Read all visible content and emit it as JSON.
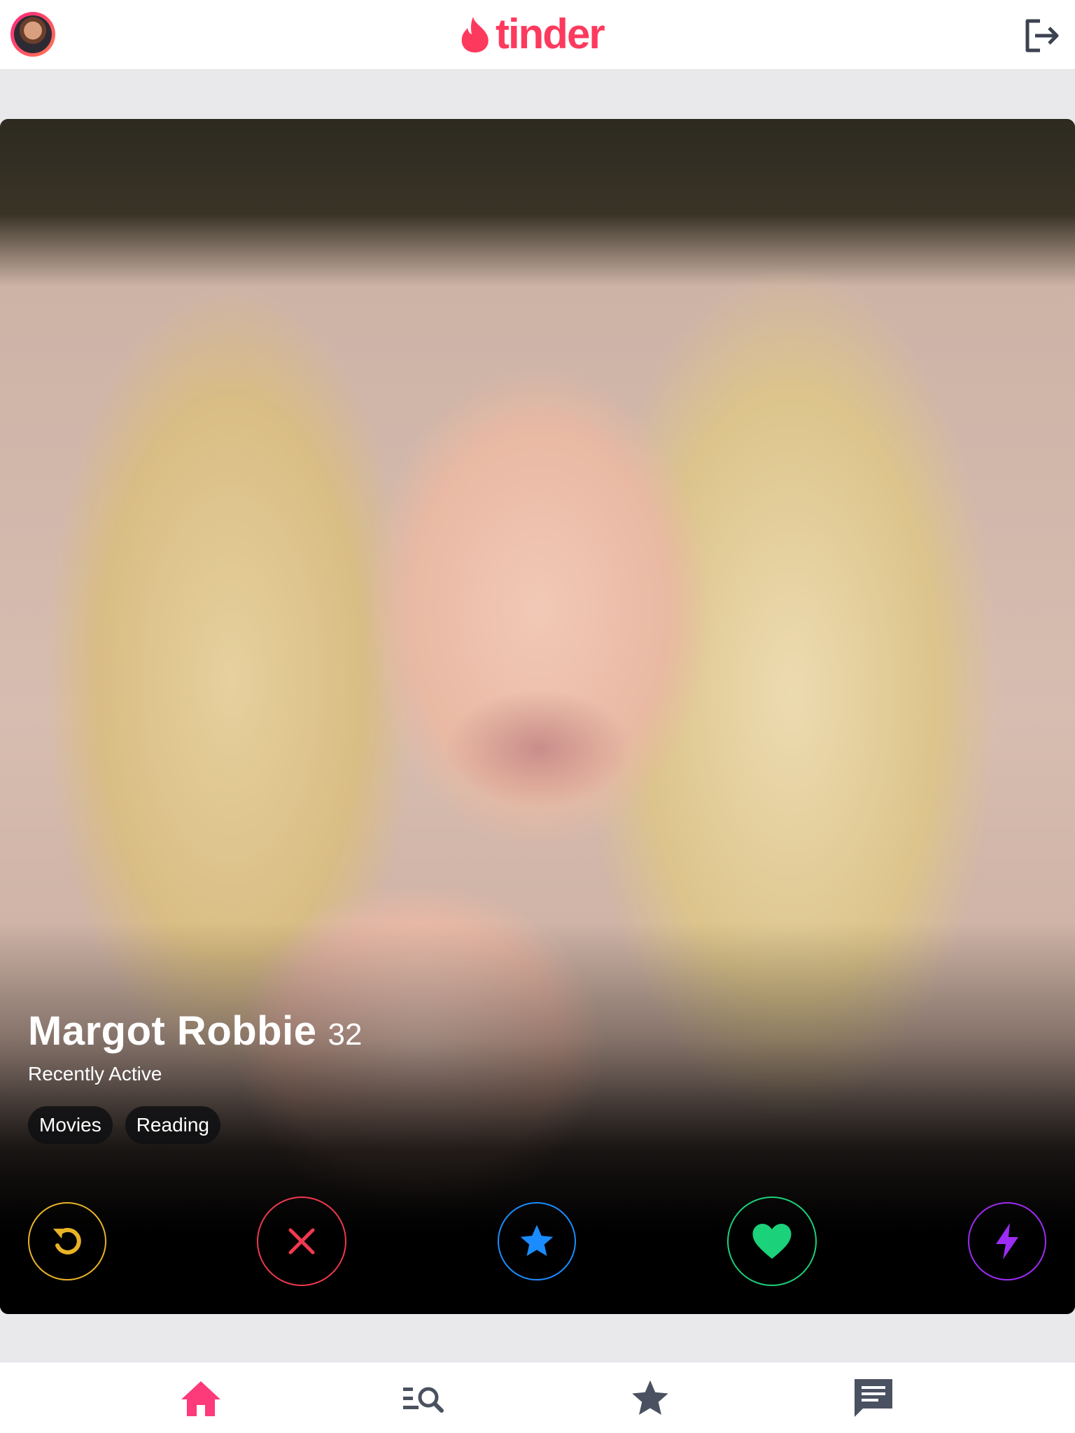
{
  "header": {
    "brand": "tinder",
    "brand_color": "#fd3a5e"
  },
  "profile": {
    "name": "Margot Robbie",
    "age": "32",
    "status": "Recently Active",
    "tags": [
      "Movies",
      "Reading"
    ]
  },
  "actions": [
    {
      "id": "rewind",
      "icon": "rewind-icon",
      "color": "#e8b326"
    },
    {
      "id": "nope",
      "icon": "close-icon",
      "color": "#f0394e"
    },
    {
      "id": "super-like",
      "icon": "star-icon",
      "color": "#1a8cff"
    },
    {
      "id": "like",
      "icon": "heart-icon",
      "color": "#1bd17a"
    },
    {
      "id": "boost",
      "icon": "bolt-icon",
      "color": "#9c2cf3"
    }
  ],
  "nav": [
    {
      "id": "home",
      "icon": "home-icon",
      "active": true,
      "color": "#fd3a7a"
    },
    {
      "id": "explore",
      "icon": "explore-search-icon",
      "active": false,
      "color": "#4a5160"
    },
    {
      "id": "top-picks",
      "icon": "star-icon",
      "active": false,
      "color": "#4a5160"
    },
    {
      "id": "messages",
      "icon": "chat-icon",
      "active": false,
      "color": "#4a5160"
    }
  ]
}
